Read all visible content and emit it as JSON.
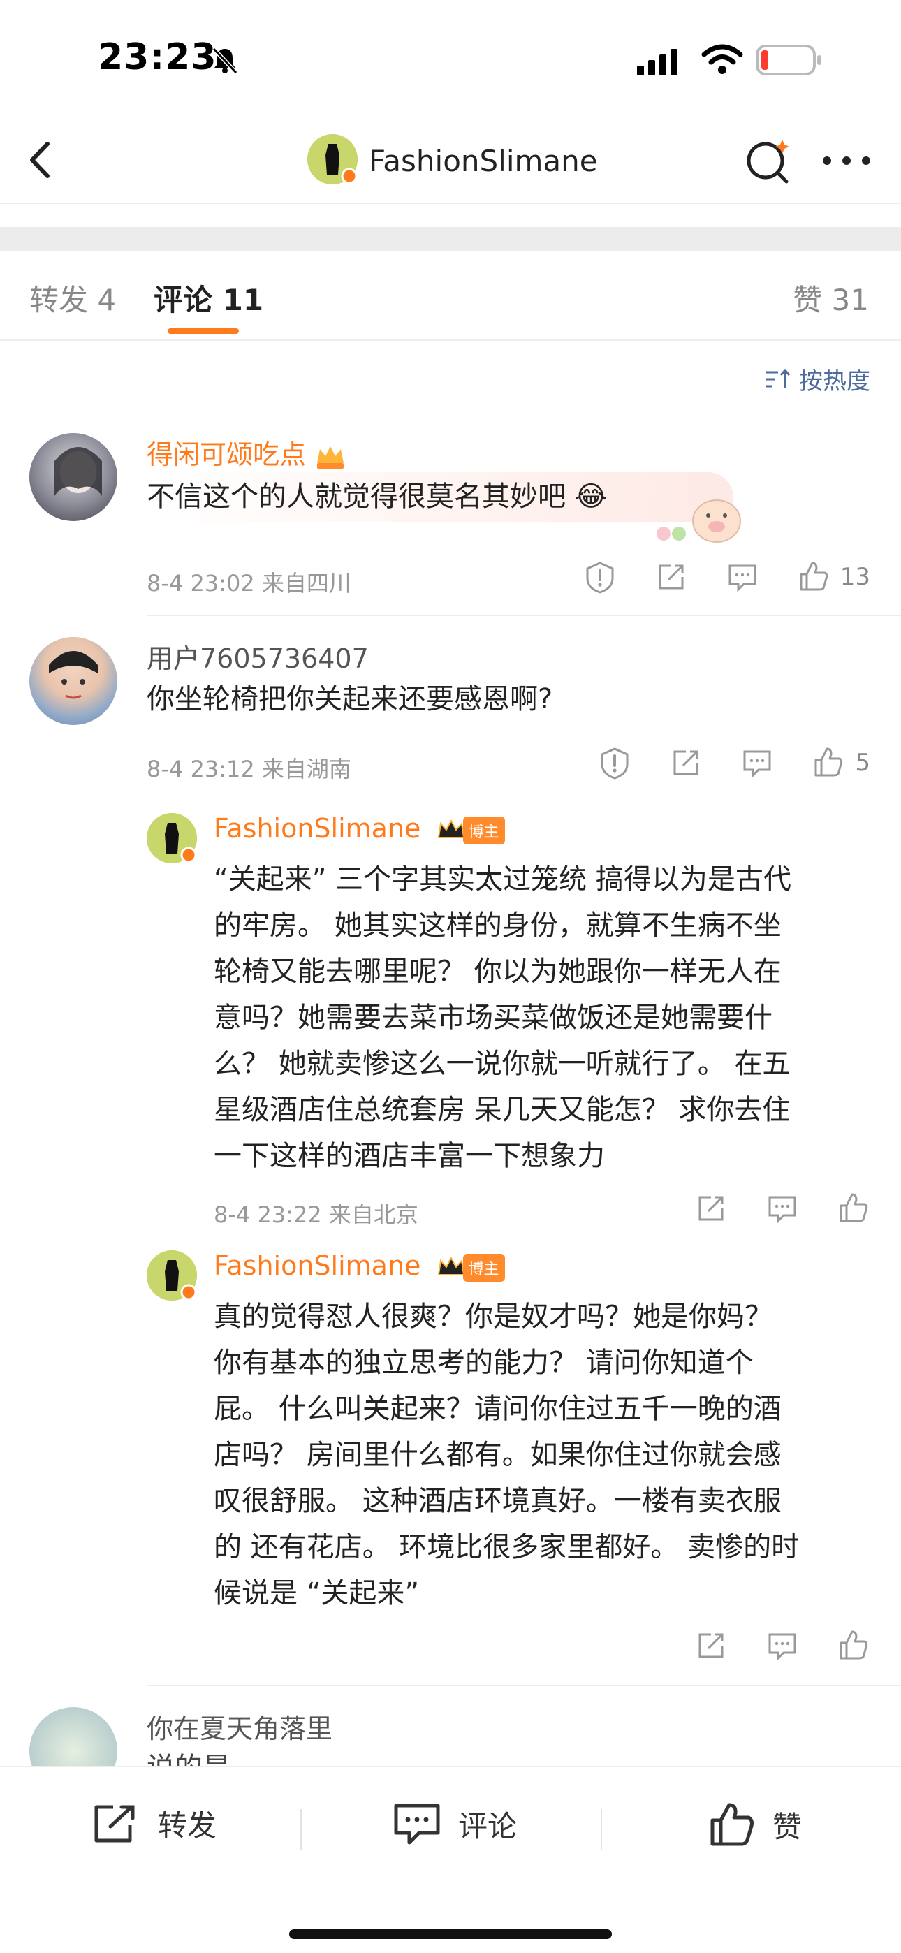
{
  "status": {
    "time": "23:23"
  },
  "nav": {
    "title": "FashionSlimane"
  },
  "tabs": {
    "repost": "转发 4",
    "comment": "评论 11",
    "like": "赞 31"
  },
  "sort": {
    "label": "按热度"
  },
  "comments": [
    {
      "user": "得闲可颂吃点",
      "text": "不信这个的人就觉得很莫名其妙吧 😂",
      "meta": "8-4 23:02  来自四川",
      "likes": "13"
    },
    {
      "user": "用户7605736407",
      "text": "你坐轮椅把你关起来还要感恩啊?",
      "meta": "8-4 23:12  来自湖南",
      "likes": "5"
    },
    {
      "user": "你在夏天角落里",
      "text": "说的是，"
    }
  ],
  "replies": [
    {
      "user": "FashionSlimane",
      "badge": "博主",
      "lines": [
        "“关起来” 三个字其实太过笼统 搞得以为是古代",
        "的牢房。 她其实这样的身份，就算不生病不坐",
        "轮椅又能去哪里呢？ 你以为她跟你一样无人在",
        "意吗？她需要去菜市场买菜做饭还是她需要什",
        "么？ 她就卖惨这么一说你就一听就行了。 在五",
        "星级酒店住总统套房 呆几天又能怎？ 求你去住",
        "一下这样的酒店丰富一下想象力"
      ],
      "meta": "8-4 23:22  来自北京"
    },
    {
      "user": "FashionSlimane",
      "badge": "博主",
      "lines": [
        "真的觉得怼人很爽？你是奴才吗？她是你妈？",
        "你有基本的独立思考的能力？ 请问你知道个",
        "屁。 什么叫关起来？请问你住过五千一晚的酒",
        "店吗？ 房间里什么都有。如果你住过你就会感",
        "叹很舒服。 这种酒店环境真好。一楼有卖衣服",
        "的 还有花店。 环境比很多家里都好。 卖惨的时",
        "候说是 “关起来”"
      ]
    }
  ],
  "bottom": {
    "repost": "转发",
    "comment": "评论",
    "like": "赞"
  },
  "colors": {
    "accent": "#ff7a1a",
    "link": "#4c6b9c",
    "badge": "#ff8b2c"
  }
}
